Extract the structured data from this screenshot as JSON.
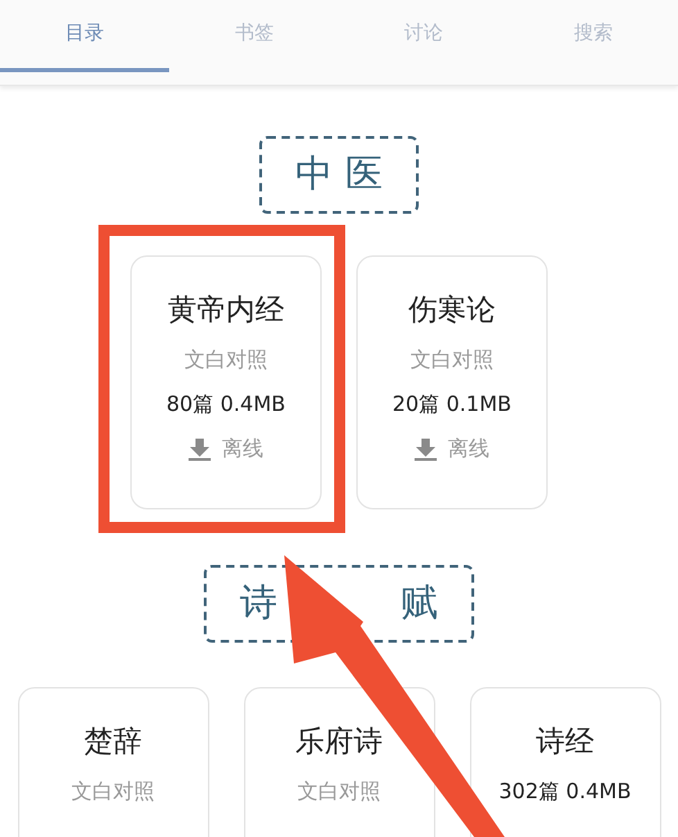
{
  "tabs": [
    {
      "label": "目录",
      "selected": true
    },
    {
      "label": "书签",
      "selected": false
    },
    {
      "label": "讨论",
      "selected": false
    },
    {
      "label": "搜索",
      "selected": false
    }
  ],
  "sections": [
    {
      "title_parts": [
        "中 医"
      ],
      "books": [
        {
          "title": "黄帝内经",
          "subtitle": "文白对照",
          "size": "80篇 0.4MB",
          "offline": "离线",
          "highlighted": true
        },
        {
          "title": "伤寒论",
          "subtitle": "文白对照",
          "size": "20篇 0.1MB",
          "offline": "离线",
          "highlighted": false
        }
      ]
    },
    {
      "title_parts": [
        "诗",
        "赋"
      ],
      "books": [
        {
          "title": "楚辞",
          "subtitle": "文白对照",
          "highlighted": false
        },
        {
          "title": "乐府诗",
          "subtitle": "文白对照",
          "highlighted": false
        },
        {
          "title": "诗经",
          "size": "302篇 0.4MB",
          "highlighted": false
        }
      ]
    }
  ]
}
